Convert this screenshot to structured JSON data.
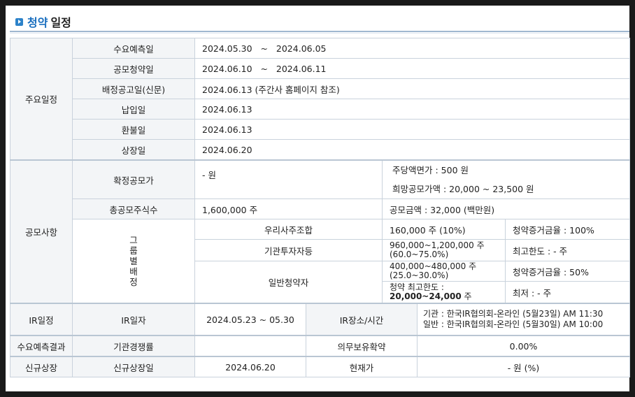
{
  "header": {
    "title_accent": "청약",
    "title_rest": "일정"
  },
  "schedule": {
    "section": "주요일정",
    "rows": [
      {
        "label": "수요예측일",
        "start": "2024.05.30",
        "sep": "~",
        "end": "2024.06.05"
      },
      {
        "label": "공모청약일",
        "start": "2024.06.10",
        "sep": "~",
        "end": "2024.06.11"
      },
      {
        "label": "배정공고일(신문)",
        "value": "2024.06.13 (주간사 홈페이지 참조)"
      },
      {
        "label": "납입일",
        "value": "2024.06.13"
      },
      {
        "label": "환불일",
        "value": "2024.06.13"
      },
      {
        "label": "상장일",
        "value": "2024.06.20"
      }
    ]
  },
  "offering": {
    "section": "공모사항",
    "final_price_label": "확정공모가",
    "final_price_value": "- 원",
    "par_value": "주당액면가 :  500 원",
    "desired_price": "희망공모가액 :  20,000 ~ 23,500 원",
    "total_shares_label": "총공모주식수",
    "total_shares_value": "1,600,000 주",
    "offering_amount": "공모금액 :  32,000 (백만원)",
    "group_label": "그룹별배정",
    "groups": [
      {
        "name": "우리사주조합",
        "shares": "160,000 주  (10%)",
        "note": "청약증거금율 : 100%"
      },
      {
        "name": "기관투자자등",
        "shares_line1": " 960,000~1,200,000 주",
        "shares_line2": "(60.0~75.0%)",
        "note": "최고한도 :   - 주"
      },
      {
        "name": "일반청약자",
        "shares_line1": " 400,000~480,000 주",
        "shares_line2": "(25.0~30.0%)",
        "note": "청약증거금율 : 50%",
        "limit_line1": "청약 최고한도 :",
        "limit_value": "20,000~24,000",
        "limit_unit": " 주",
        "note2": "최저 :   - 주"
      }
    ]
  },
  "ir": {
    "section": "IR일정",
    "date_label": "IR일자",
    "date_value": "2024.05.23 ~ 05.30",
    "place_label": "IR장소/시간",
    "place_line1": "기관 : 한국IR협의회-온라인 (5월23일) AM 11:30",
    "place_line2": "일반 : 한국IR협의회-온라인 (5월30일) AM 10:00"
  },
  "demand": {
    "section": "수요예측결과",
    "competition_label": "기관경쟁률",
    "competition_value": "",
    "lockup_label": "의무보유확약",
    "lockup_value": "0.00%"
  },
  "listing": {
    "section": "신규상장",
    "date_label": "신규상장일",
    "date_value": "2024.06.20",
    "price_label": "현재가",
    "price_value": "- 원 (%)"
  }
}
